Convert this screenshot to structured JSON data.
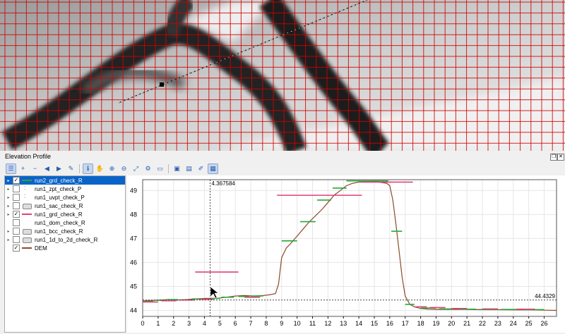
{
  "map": {
    "background": "#d8d8d8",
    "grid_color": "#d40000",
    "line_color": "#111111"
  },
  "panel": {
    "title": "Elevation Profile",
    "float_icon": "float-icon",
    "close_icon": "close-icon"
  },
  "toolbar": {
    "icons": [
      "layer-list-icon",
      "add-layer-icon",
      "remove-layer-icon",
      "move-up-icon",
      "move-down-icon",
      "highlight-icon",
      "identify-icon",
      "pan-icon",
      "zoom-in-icon",
      "zoom-out-icon",
      "zoom-full-icon",
      "settings-icon",
      "table-icon",
      "export-image-icon",
      "export-data-icon",
      "measure-icon",
      "properties-icon"
    ]
  },
  "layers": [
    {
      "name": "run2_grd_check_R",
      "checked": true,
      "expandable": true,
      "symbol": "line",
      "color": "#27a83a",
      "selected": true
    },
    {
      "name": "run1_zpt_check_P",
      "checked": false,
      "expandable": true,
      "symbol": "points",
      "color": "#666666",
      "selected": false
    },
    {
      "name": "run1_uvpt_check_P",
      "checked": false,
      "expandable": true,
      "symbol": "points",
      "color": "#666666",
      "selected": false
    },
    {
      "name": "run1_sac_check_R",
      "checked": false,
      "expandable": true,
      "symbol": "polygon",
      "color": "#888888",
      "selected": false
    },
    {
      "name": "run1_grd_check_R",
      "checked": true,
      "expandable": true,
      "symbol": "line",
      "color": "#e0407a",
      "selected": false
    },
    {
      "name": "run1_dom_check_R",
      "checked": false,
      "expandable": false,
      "symbol": "none",
      "color": "#ffffff",
      "selected": false
    },
    {
      "name": "run1_bcc_check_R",
      "checked": false,
      "expandable": true,
      "symbol": "polygon",
      "color": "#888888",
      "selected": false
    },
    {
      "name": "run1_1d_to_2d_check_R",
      "checked": false,
      "expandable": true,
      "symbol": "polygon",
      "color": "#888888",
      "selected": false
    },
    {
      "name": "DEM",
      "checked": true,
      "expandable": false,
      "symbol": "line",
      "color": "#8b4a2b",
      "selected": false
    }
  ],
  "chart_data": {
    "type": "line",
    "xlim": [
      0,
      26.8
    ],
    "ylim": [
      43.75,
      49.45
    ],
    "x_ticks": [
      "0",
      "1",
      "2",
      "3",
      "4",
      "5",
      "6",
      "7",
      "8",
      "9",
      "10",
      "11",
      "12",
      "13",
      "14",
      "15",
      "16",
      "17",
      "18",
      "19",
      "20",
      "21",
      "22",
      "23",
      "24",
      "25",
      "26"
    ],
    "y_ticks": [
      "44",
      "45",
      "46",
      "47",
      "48",
      "49"
    ],
    "crosshair": {
      "x": 4.367584,
      "y": 44.4329,
      "x_label": "4.367584",
      "y_label": "44.4329"
    },
    "series": [
      {
        "color": "#8b4a2b",
        "x": [
          0,
          0.8,
          1.6,
          2.4,
          3.2,
          4.0,
          4.8,
          5.4,
          6.0,
          6.6,
          7.2,
          7.8,
          8.2,
          8.6,
          8.8,
          9.0,
          9.3,
          9.6,
          10.0,
          10.4,
          10.8,
          11.2,
          11.6,
          12.0,
          12.4,
          12.8,
          13.2,
          13.6,
          14.0,
          14.6,
          15.2,
          15.8,
          16.0,
          16.2,
          16.4,
          16.6,
          16.8,
          17.0,
          17.3,
          17.6,
          18.0,
          18.5,
          19.0,
          20.0,
          21.0,
          22.0,
          23.0,
          24.0,
          25.0,
          26.0,
          26.8
        ],
        "y": [
          44.4,
          44.42,
          44.45,
          44.43,
          44.47,
          44.5,
          44.5,
          44.55,
          44.6,
          44.62,
          44.6,
          44.62,
          44.65,
          44.7,
          45.1,
          46.2,
          46.6,
          46.8,
          47.1,
          47.4,
          47.7,
          47.95,
          48.2,
          48.5,
          48.8,
          49.0,
          49.2,
          49.3,
          49.35,
          49.35,
          49.36,
          49.3,
          49.2,
          48.6,
          47.6,
          46.5,
          45.4,
          44.6,
          44.25,
          44.15,
          44.08,
          44.05,
          44.04,
          44.04,
          44.04,
          44.03,
          44.03,
          44.02,
          44.02,
          44.01,
          44.0
        ]
      },
      {
        "color": "#27a83a",
        "segments": [
          [
            0.0,
            0.7,
            44.38
          ],
          [
            0.8,
            1.5,
            44.42
          ],
          [
            1.6,
            2.3,
            44.45
          ],
          [
            2.4,
            3.1,
            44.44
          ],
          [
            3.2,
            4.0,
            44.48
          ],
          [
            4.3,
            5.0,
            44.5
          ],
          [
            5.1,
            5.9,
            44.55
          ],
          [
            6.2,
            6.9,
            44.58
          ],
          [
            7.0,
            7.8,
            44.6
          ],
          [
            9.0,
            10.0,
            46.9
          ],
          [
            10.2,
            11.2,
            47.7
          ],
          [
            11.3,
            12.2,
            48.6
          ],
          [
            12.3,
            13.2,
            49.1
          ],
          [
            13.2,
            15.9,
            49.4
          ],
          [
            16.1,
            16.8,
            47.3
          ],
          [
            17.0,
            17.6,
            44.25
          ],
          [
            18.0,
            19.0,
            44.1
          ],
          [
            19.2,
            20.2,
            44.06
          ],
          [
            20.4,
            21.6,
            44.05
          ],
          [
            21.8,
            23.0,
            44.04
          ],
          [
            23.2,
            24.4,
            44.04
          ],
          [
            24.6,
            26.0,
            44.03
          ]
        ]
      },
      {
        "color": "#e0407a",
        "segments": [
          [
            0.0,
            1.0,
            44.35
          ],
          [
            1.2,
            2.2,
            44.4
          ],
          [
            2.4,
            3.4,
            44.43
          ],
          [
            3.6,
            4.6,
            44.46
          ],
          [
            3.4,
            6.2,
            45.6
          ],
          [
            6.6,
            7.6,
            44.55
          ],
          [
            8.7,
            14.2,
            48.8
          ],
          [
            14.2,
            17.5,
            49.35
          ],
          [
            17.6,
            18.4,
            44.15
          ],
          [
            18.6,
            19.6,
            44.12
          ],
          [
            20.0,
            21.0,
            44.08
          ],
          [
            22.0,
            23.0,
            44.06
          ],
          [
            24.2,
            25.4,
            44.05
          ]
        ]
      }
    ]
  }
}
